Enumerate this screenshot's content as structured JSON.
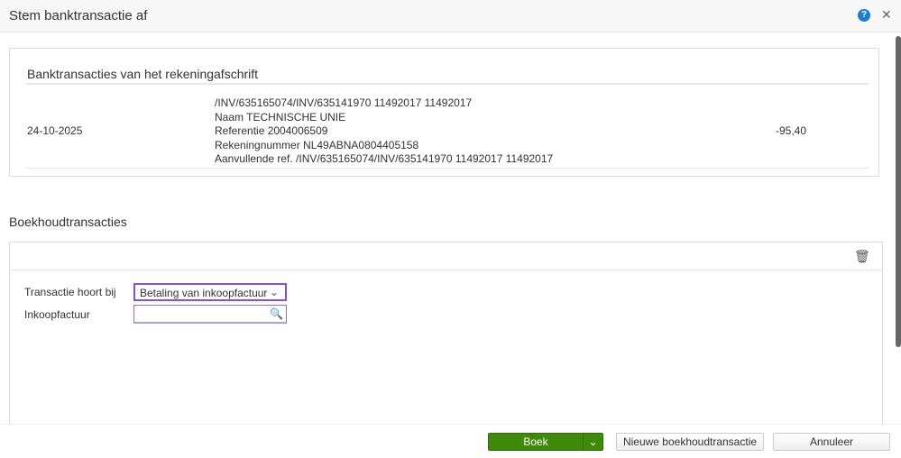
{
  "dialog": {
    "title": "Stem banktransactie af"
  },
  "bank": {
    "title": "Banktransacties van het rekeningafschrift",
    "row": {
      "date": "24-10-2025",
      "description": [
        "/INV/635165074/INV/635141970 11492017 11492017",
        "Naam TECHNISCHE UNIE",
        "Referentie 2004006509",
        "Rekeningnummer NL49ABNA0804405158",
        "Aanvullende ref. /INV/635165074/INV/635141970 11492017 11492017"
      ],
      "amount": "-95,40"
    }
  },
  "booking": {
    "title": "Boekhoudtransacties",
    "belongs_label": "Transactie hoort bij",
    "belongs_value": "Betaling van inkoopfactuur",
    "invoice_label": "Inkoopfactuur",
    "invoice_value": ""
  },
  "footer": {
    "boek": "Boek",
    "new": "Nieuwe boekhoudtransactie",
    "cancel": "Annuleer"
  }
}
